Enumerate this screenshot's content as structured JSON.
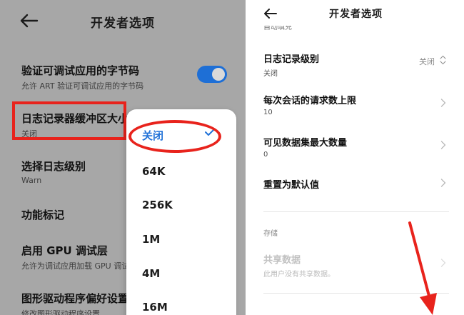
{
  "left": {
    "title": "开发者选项",
    "items": [
      {
        "title": "验证可调试应用的字节码",
        "subtitle": "允许 ART 验证可调试应用的字节码",
        "toggle_on": true
      },
      {
        "title": "日志记录器缓冲区大小",
        "subtitle": "关闭"
      },
      {
        "title": "选择日志级别",
        "subtitle": "Warn"
      },
      {
        "title": "功能标记",
        "subtitle": ""
      },
      {
        "title": "启用 GPU 调试层",
        "subtitle": "允许为调试应用加载 GPU 调试层"
      },
      {
        "title": "图形驱动程序偏好设置",
        "subtitle": "修改图形驱动程序设置"
      }
    ],
    "dropdown": {
      "options": [
        "关闭",
        "64K",
        "256K",
        "1M",
        "4M",
        "16M"
      ],
      "selected": "关闭"
    }
  },
  "right": {
    "title": "开发者选项",
    "cutoff_text": "自动填充",
    "items": [
      {
        "title": "日志记录级别",
        "subtitle": "关闭",
        "value": "关闭"
      },
      {
        "title": "每次会话的请求数上限",
        "subtitle": "10"
      },
      {
        "title": "可见数据集最大数量",
        "subtitle": "0"
      },
      {
        "title": "重置为默认值",
        "subtitle": ""
      }
    ],
    "section": "存储",
    "shared": {
      "title": "共享数据",
      "subtitle": "此用户没有共享数据。"
    }
  },
  "colors": {
    "accent": "#2373d8",
    "highlight_red": "#e8231c",
    "dim_background": "#a7a7a7"
  }
}
